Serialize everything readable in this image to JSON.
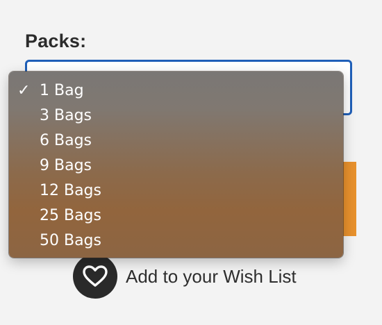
{
  "form": {
    "packs_label": "Packs:",
    "selected_value": "1 Bag"
  },
  "dropdown": {
    "options": [
      {
        "label": "1 Bag",
        "selected": true
      },
      {
        "label": "3 Bags",
        "selected": false
      },
      {
        "label": "6 Bags",
        "selected": false
      },
      {
        "label": "9 Bags",
        "selected": false
      },
      {
        "label": "12 Bags",
        "selected": false
      },
      {
        "label": "25 Bags",
        "selected": false
      },
      {
        "label": "50 Bags",
        "selected": false
      }
    ],
    "check_glyph": "✓"
  },
  "wishlist": {
    "label": "Add to your Wish List",
    "icon": "heart-icon"
  },
  "colors": {
    "select_border": "#1f5fb8",
    "cart_button": "#e8912d",
    "heart_circle": "#2a2a2a"
  }
}
